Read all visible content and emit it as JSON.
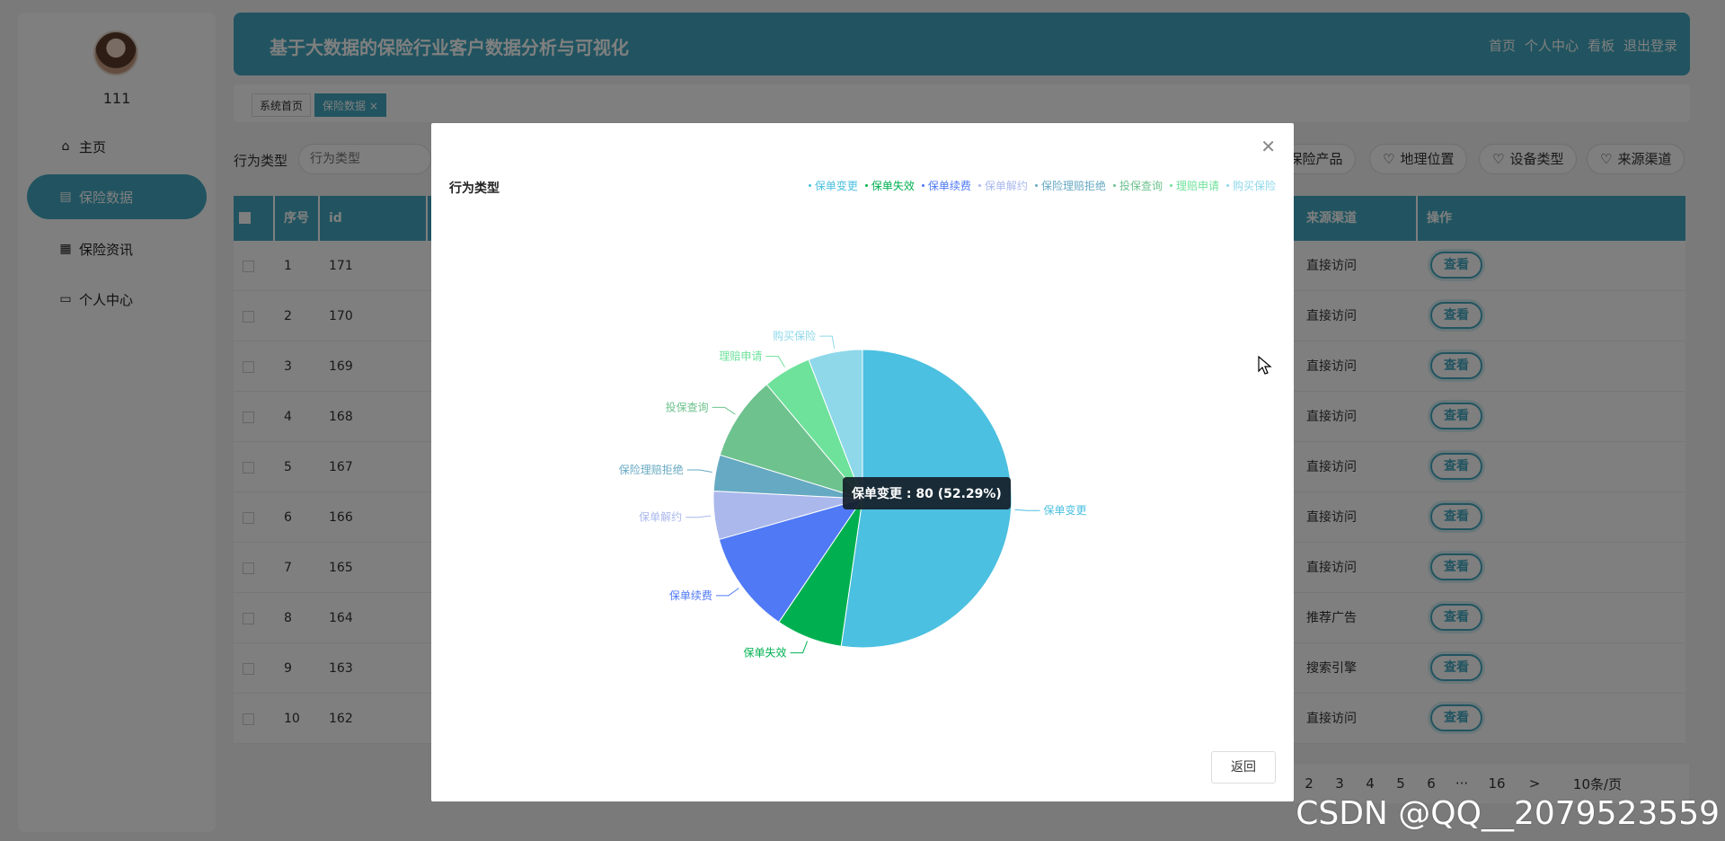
{
  "sidebar": {
    "username": "111",
    "items": [
      {
        "label": "主页",
        "icon": "home-icon"
      },
      {
        "label": "保险数据",
        "icon": "clipboard-icon"
      },
      {
        "label": "保险资讯",
        "icon": "grid-icon"
      },
      {
        "label": "个人中心",
        "icon": "card-icon"
      }
    ]
  },
  "header": {
    "title": "基于大数据的保险行业客户数据分析与可视化",
    "nav": [
      "首页",
      "个人中心",
      "看板",
      "退出登录"
    ]
  },
  "tabs": [
    {
      "label": "系统首页"
    },
    {
      "label": "保险数据 ×"
    }
  ],
  "search": {
    "label": "行为类型",
    "placeholder": "行为类型",
    "filters": [
      "保险产品",
      "地理位置",
      "设备类型",
      "来源渠道"
    ]
  },
  "table": {
    "headers": [
      "序号",
      "id",
      "来源渠道",
      "操作"
    ],
    "view_label": "查看",
    "rows": [
      {
        "index": "1",
        "id": "171",
        "channel": "直接访问"
      },
      {
        "index": "2",
        "id": "170",
        "channel": "直接访问"
      },
      {
        "index": "3",
        "id": "169",
        "channel": "直接访问"
      },
      {
        "index": "4",
        "id": "168",
        "channel": "直接访问"
      },
      {
        "index": "5",
        "id": "167",
        "channel": "直接访问"
      },
      {
        "index": "6",
        "id": "166",
        "channel": "直接访问"
      },
      {
        "index": "7",
        "id": "165",
        "channel": "直接访问"
      },
      {
        "index": "8",
        "id": "164",
        "channel": "推荐广告"
      },
      {
        "index": "9",
        "id": "163",
        "channel": "搜索引擎"
      },
      {
        "index": "10",
        "id": "162",
        "channel": "直接访问"
      }
    ]
  },
  "pagination": {
    "pages": [
      "2",
      "3",
      "4",
      "5",
      "6",
      "···",
      "16",
      ">"
    ],
    "page_size": "10条/页"
  },
  "modal": {
    "close_icon": "close-icon",
    "return_label": "返回",
    "tooltip": "保单变更 : 80 (52.29%)"
  },
  "chart_data": {
    "type": "pie",
    "title": "行为类型",
    "legend_position": "top-right",
    "series": [
      {
        "name": "保单变更",
        "value": 80,
        "color": "#4bc0e0"
      },
      {
        "name": "保单失效",
        "value": 11,
        "color": "#00b050"
      },
      {
        "name": "保单续费",
        "value": 17,
        "color": "#4f79f5"
      },
      {
        "name": "保单解约",
        "value": 8,
        "color": "#aab8ec"
      },
      {
        "name": "保险理赔拒绝",
        "value": 6,
        "color": "#66a9c2"
      },
      {
        "name": "投保查询",
        "value": 14,
        "color": "#6dc28e"
      },
      {
        "name": "理赔申请",
        "value": 8,
        "color": "#6ee29b"
      },
      {
        "name": "购买保险",
        "value": 9,
        "color": "#8ed8ea"
      }
    ]
  },
  "watermark": "CSDN @QQ__2079523559"
}
